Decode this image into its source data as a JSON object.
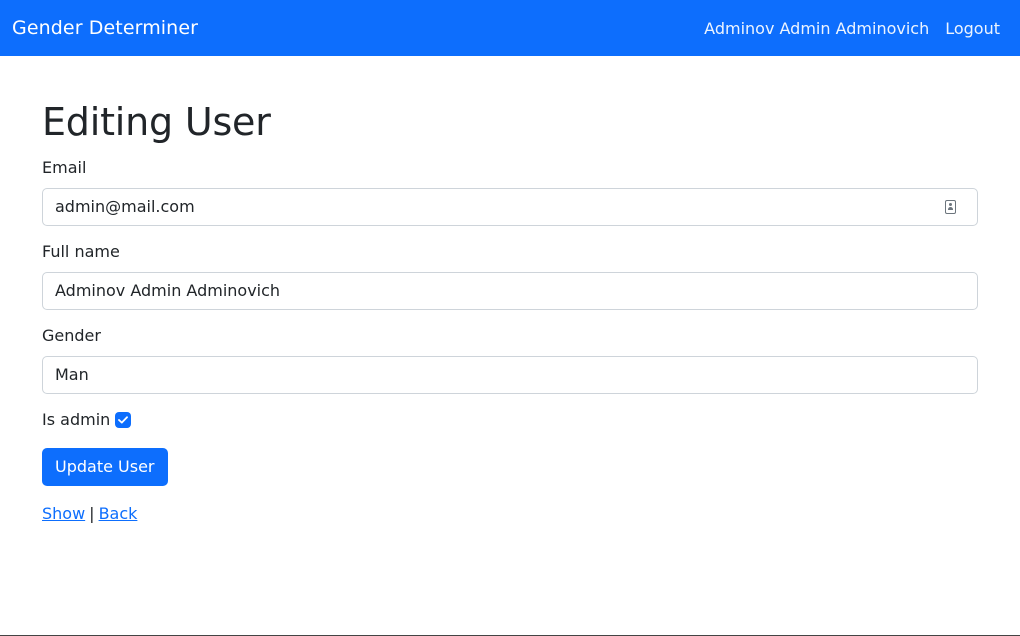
{
  "navbar": {
    "brand": "Gender Determiner",
    "user_name": "Adminov Admin Adminovich",
    "logout_label": "Logout",
    "bg_color": "#0d6efd"
  },
  "page": {
    "title": "Editing User"
  },
  "form": {
    "email": {
      "label": "Email",
      "value": "admin@mail.com",
      "icon": "contact-card-icon"
    },
    "full_name": {
      "label": "Full name",
      "value": "Adminov Admin Adminovich"
    },
    "gender": {
      "label": "Gender",
      "value": "Man"
    },
    "is_admin": {
      "label": "Is admin",
      "checked": true
    },
    "submit_label": "Update User"
  },
  "links": {
    "show": "Show",
    "separator": "|",
    "back": "Back"
  }
}
